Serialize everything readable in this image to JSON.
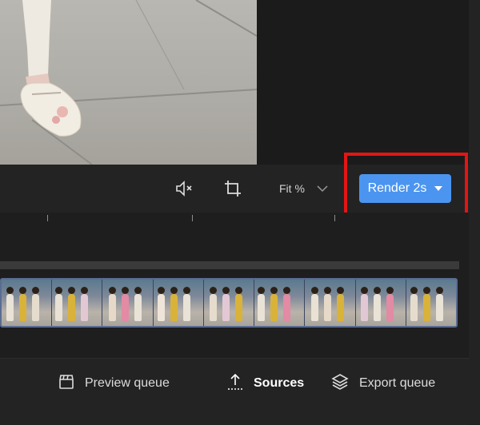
{
  "toolbar": {
    "mute_icon": "speaker-muted-icon",
    "crop_icon": "crop-icon",
    "fit_label": "Fit %",
    "fit_dropdown_icon": "chevron-down-icon",
    "render_label": "Render 2s",
    "render_dropdown_icon": "caret-down-icon"
  },
  "timeline": {
    "clip_thumbnails": 9
  },
  "bottom_nav": {
    "items": [
      {
        "label": "Preview queue",
        "icon": "clapperboard-icon"
      },
      {
        "label": "Sources",
        "icon": "upload-icon",
        "active": true
      },
      {
        "label": "Export queue",
        "icon": "layers-icon"
      }
    ]
  },
  "colors": {
    "accent": "#4b95f0",
    "highlight": "#e41515",
    "background": "#1f1f1f"
  }
}
